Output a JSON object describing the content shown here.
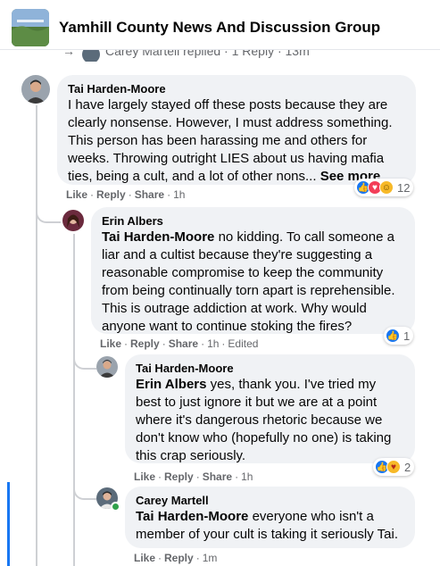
{
  "header": {
    "group_name": "Yamhill County News And Discussion Group"
  },
  "collapsed_reply": {
    "text": "Carey Martell replied · 1 Reply · 13m"
  },
  "comments": [
    {
      "author": "Tai Harden-Moore",
      "text": "I have largely stayed off these posts because they are clearly nonsense. However, I must address something. This person has been harassing me and others for weeks. Throwing outright LIES about us having mafia ties, being a cult, and a lot of other nons...",
      "see_more": "See more",
      "actions": {
        "like": "Like",
        "reply": "Reply",
        "share": "Share",
        "time": "1h"
      },
      "reactions": {
        "icons": [
          "like-icon",
          "love-icon",
          "haha-icon"
        ],
        "count": "12"
      }
    },
    {
      "author": "Erin Albers",
      "mention": "Tai Harden-Moore",
      "text": " no kidding. To call someone a liar and a cultist because they're suggesting a reasonable compromise to keep the community from being continually torn apart is reprehensible. This is outrage addiction at work. Why would anyone want to continue stoking the fires?",
      "actions": {
        "like": "Like",
        "reply": "Reply",
        "share": "Share",
        "time": "1h",
        "edited": "Edited"
      },
      "reactions": {
        "icons": [
          "like-icon"
        ],
        "count": "1"
      }
    },
    {
      "author": "Tai Harden-Moore",
      "mention": "Erin Albers",
      "text": " yes, thank you. I've tried my best to just ignore it but we are at a point where it's dangerous rhetoric because we don't know who (hopefully no one) is taking this crap seriously.",
      "actions": {
        "like": "Like",
        "reply": "Reply",
        "share": "Share",
        "time": "1h"
      },
      "reactions": {
        "icons": [
          "like-icon",
          "care-icon"
        ],
        "count": "2"
      }
    },
    {
      "author": "Carey Martell",
      "mention": "Tai Harden-Moore",
      "text": " everyone who isn't a member of your cult is taking it seriously Tai.",
      "actions": {
        "like": "Like",
        "reply": "Reply",
        "time": "1m"
      }
    }
  ],
  "colors": {
    "bubble": "#f0f2f5",
    "meta_text": "#65676b",
    "like_blue": "#1877f2",
    "online_green": "#31a24c"
  }
}
